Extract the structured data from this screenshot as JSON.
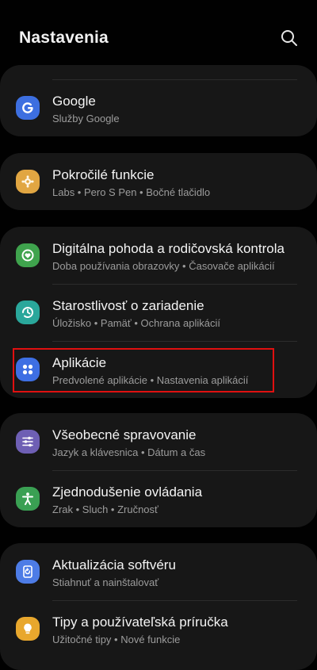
{
  "header": {
    "title": "Nastavenia",
    "search_icon": "search-icon"
  },
  "colors": {
    "google": "#3d6fe0",
    "advanced": "#e1a642",
    "wellbeing": "#3fa34d",
    "device_care": "#2aa79b",
    "apps": "#3e6fe3",
    "general": "#6e5fb4",
    "accessibility": "#3aa053",
    "software_update": "#4d7ce6",
    "tips": "#e8a72d",
    "highlight": "#e01010"
  },
  "items": [
    {
      "label": "Google",
      "sub": "Služby Google",
      "icon": "google-icon"
    },
    {
      "label": "Pokročilé funkcie",
      "sub": "Labs  •  Pero S Pen  •  Bočné tlačidlo",
      "icon": "advanced-features-icon"
    },
    {
      "label": "Digitálna pohoda a rodičovská kontrola",
      "sub": "Doba používania obrazovky  •  Časovače aplikácií",
      "icon": "digital-wellbeing-icon"
    },
    {
      "label": "Starostlivosť o zariadenie",
      "sub": "Úložisko  •  Pamäť  •  Ochrana aplikácií",
      "icon": "device-care-icon"
    },
    {
      "label": "Aplikácie",
      "sub": "Predvolené aplikácie  •  Nastavenia aplikácií",
      "icon": "apps-icon"
    },
    {
      "label": "Všeobecné spravovanie",
      "sub": "Jazyk a klávesnica  •  Dátum a čas",
      "icon": "general-management-icon"
    },
    {
      "label": "Zjednodušenie ovládania",
      "sub": "Zrak  •  Sluch  •  Zručnosť",
      "icon": "accessibility-icon"
    },
    {
      "label": "Aktualizácia softvéru",
      "sub": "Stiahnuť a nainštalovať",
      "icon": "software-update-icon"
    },
    {
      "label": "Tipy a používateľská príručka",
      "sub": "Užitočné tipy  •  Nové funkcie",
      "icon": "tips-icon"
    }
  ]
}
